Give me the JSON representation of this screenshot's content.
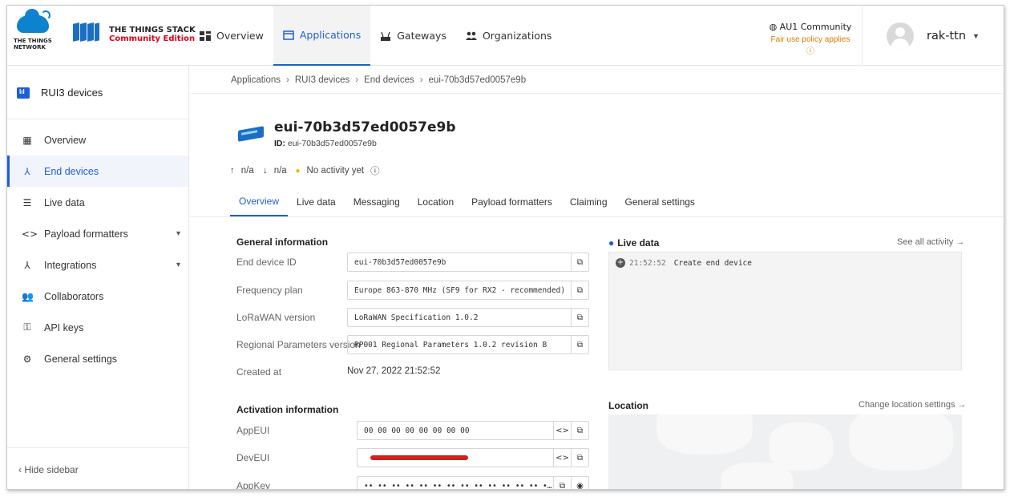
{
  "brand": {
    "ttn_line1": "THE THINGS",
    "ttn_line2": "NETWORK",
    "stack_title": "THE THINGS STACK",
    "stack_edition": "Community Edition"
  },
  "topnav": {
    "items": [
      {
        "label": "Overview",
        "icon": "overview-grid-icon"
      },
      {
        "label": "Applications",
        "icon": "applications-icon"
      },
      {
        "label": "Gateways",
        "icon": "gateway-icon"
      },
      {
        "label": "Organizations",
        "icon": "organizations-icon"
      }
    ],
    "community": "AU1 Community",
    "fair_use": "Fair use policy applies",
    "username": "rak-ttn"
  },
  "sidebar": {
    "app_name": "RUI3 devices",
    "items": [
      {
        "label": "Overview",
        "icon": "overview-grid-icon"
      },
      {
        "label": "End devices",
        "icon": "end-devices-icon"
      },
      {
        "label": "Live data",
        "icon": "live-data-icon"
      },
      {
        "label": "Payload formatters",
        "icon": "code-icon"
      },
      {
        "label": "Integrations",
        "icon": "integrations-icon"
      },
      {
        "label": "Collaborators",
        "icon": "collaborators-icon"
      },
      {
        "label": "API keys",
        "icon": "key-icon"
      },
      {
        "label": "General settings",
        "icon": "gear-icon"
      }
    ],
    "hide_label": "Hide sidebar"
  },
  "breadcrumbs": [
    "Applications",
    "RUI3 devices",
    "End devices",
    "eui-70b3d57ed0057e9b"
  ],
  "device": {
    "title": "eui-70b3d57ed0057e9b",
    "id_label": "ID:",
    "id_value": "eui-70b3d57ed0057e9b",
    "uplink": "n/a",
    "downlink": "n/a",
    "activity": "No activity yet"
  },
  "tabs": [
    "Overview",
    "Live data",
    "Messaging",
    "Location",
    "Payload formatters",
    "Claiming",
    "General settings"
  ],
  "general_info": {
    "title": "General information",
    "rows": [
      {
        "label": "End device ID",
        "value": "eui-70b3d57ed0057e9b"
      },
      {
        "label": "Frequency plan",
        "value": "Europe 863-870 MHz (SF9 for RX2 - recommended)"
      },
      {
        "label": "LoRaWAN version",
        "value": "LoRaWAN Specification 1.0.2"
      },
      {
        "label": "Regional Parameters version",
        "value": "RP001 Regional Parameters 1.0.2 revision B"
      },
      {
        "label": "Created at",
        "value": "Nov 27, 2022 21:52:52"
      }
    ]
  },
  "activation_info": {
    "title": "Activation information",
    "rows": [
      {
        "label": "AppEUI",
        "value": "00 00 00 00 00 00 00 00"
      },
      {
        "label": "DevEUI",
        "value": ""
      },
      {
        "label": "AppKey",
        "value": "•• •• •• •• •• •• •• •• •• •• •• •• •• •• •• ••"
      }
    ]
  },
  "live_data": {
    "title": "Live data",
    "see_all": "See all activity →",
    "entries": [
      {
        "time": "21:52:52",
        "text": "Create end device"
      }
    ]
  },
  "location": {
    "title": "Location",
    "link": "Change location settings →"
  },
  "colors": {
    "accent": "#1e5fd6",
    "brand_red": "#e0001b",
    "ttn_blue": "#0d83d0",
    "warning": "#d67f00"
  }
}
